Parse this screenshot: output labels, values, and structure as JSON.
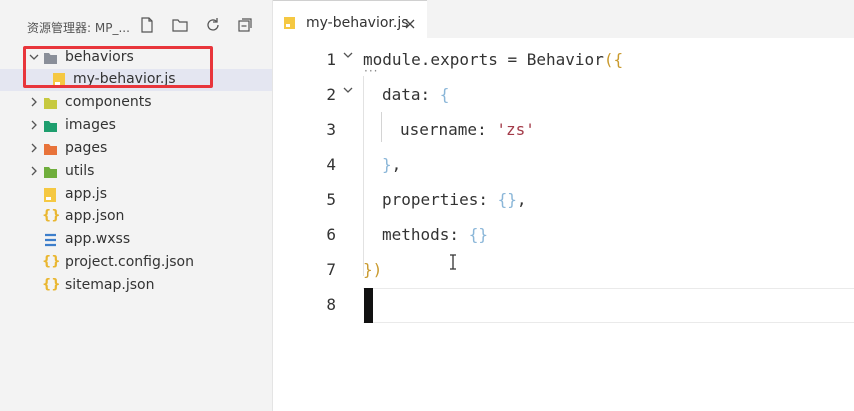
{
  "explorer": {
    "title": "资源管理器: MP_...",
    "toolbar": {
      "new_file_icon": "new-file-icon",
      "new_folder_icon": "new-folder-icon",
      "refresh_icon": "refresh-icon",
      "collapse_icon": "collapse-all-icon"
    },
    "tree": [
      {
        "label": "behaviors",
        "type": "folder",
        "expanded": true,
        "icon_color": "#8a8f99"
      },
      {
        "label": "my-behavior.js",
        "type": "file-js",
        "selected": true,
        "icon_color": "#f5c842"
      },
      {
        "label": "components",
        "type": "folder",
        "expanded": false,
        "icon_color": "#c7c940"
      },
      {
        "label": "images",
        "type": "folder",
        "expanded": false,
        "icon_color": "#1e9e6e"
      },
      {
        "label": "pages",
        "type": "folder",
        "expanded": false,
        "icon_color": "#e8733a"
      },
      {
        "label": "utils",
        "type": "folder",
        "expanded": false,
        "icon_color": "#6fae3c"
      },
      {
        "label": "app.js",
        "type": "file-js",
        "icon_color": "#f5c842"
      },
      {
        "label": "app.json",
        "type": "file-json",
        "icon_color": "#e9b630"
      },
      {
        "label": "app.wxss",
        "type": "file-css",
        "icon_color": "#3d7ecb"
      },
      {
        "label": "project.config.json",
        "type": "file-json",
        "icon_color": "#e9b630"
      },
      {
        "label": "sitemap.json",
        "type": "file-json",
        "icon_color": "#e9b630"
      }
    ],
    "highlight_color": "#e8353b"
  },
  "editor": {
    "tab": {
      "label": "my-behavior.js",
      "close_icon": "close-icon",
      "icon_color": "#f5c842"
    },
    "lines": [
      {
        "number": "1",
        "text": "module.exports = Behavior({"
      },
      {
        "number": "2",
        "text": "data: {"
      },
      {
        "number": "3",
        "text": "username: 'zs'"
      },
      {
        "number": "4",
        "text": "},"
      },
      {
        "number": "5",
        "text": "properties: {},"
      },
      {
        "number": "6",
        "text": "methods: {}"
      },
      {
        "number": "7",
        "text": "})"
      },
      {
        "number": "8",
        "text": ""
      }
    ],
    "tokens": {
      "l1_a": "module.exports = Behavior",
      "l1_b": "({",
      "l2_a": "data: ",
      "l2_b": "{",
      "l3_a": "username: ",
      "l3_b": "'zs'",
      "l4_a": "}",
      "l4_b": ",",
      "l5_a": "properties: ",
      "l5_b": "{}",
      "l5_c": ",",
      "l6_a": "methods: ",
      "l6_b": "{}",
      "l7_a": "})"
    },
    "fold_dots": "···"
  }
}
